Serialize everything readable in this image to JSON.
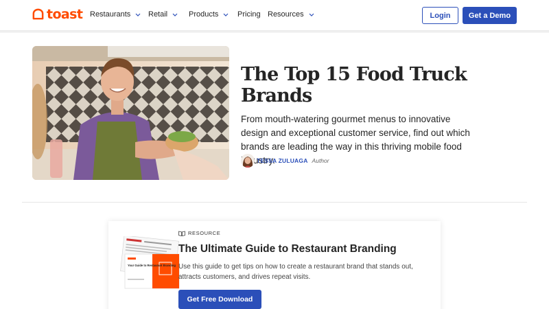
{
  "nav": {
    "logo_text": "toast",
    "items": [
      {
        "label": "Restaurants",
        "has_dropdown": true
      },
      {
        "label": "Retail",
        "has_dropdown": true
      },
      {
        "label": "Products",
        "has_dropdown": true
      },
      {
        "label": "Pricing",
        "has_dropdown": false
      },
      {
        "label": "Resources",
        "has_dropdown": true
      }
    ],
    "login_label": "Login",
    "demo_label": "Get a Demo"
  },
  "article": {
    "title": "The Top 15 Food Truck Brands",
    "description": "From mouth-watering gourmet menus to innovative design and exceptional customer service, find out which brands are leading the way in this thriving mobile food industry.",
    "author_name": "TESSA ZULUAGA",
    "author_role": "Author"
  },
  "resource": {
    "tag": "RESOURCE",
    "title": "The Ultimate Guide to Restaurant Branding",
    "description": "Use this guide to get tips on how to create a restaurant brand that stands out, attracts customers, and drives repeat visits.",
    "button_label": "Get Free Download",
    "thumbnail_text": "Your Guide to Restaurant Branding"
  },
  "colors": {
    "brand_orange": "#ff4c00",
    "primary_blue": "#2b4fb9",
    "text": "#252525"
  },
  "icons": {
    "logo": "toast-logo-icon",
    "dropdown": "chevron-down-icon",
    "resource": "book-icon"
  }
}
